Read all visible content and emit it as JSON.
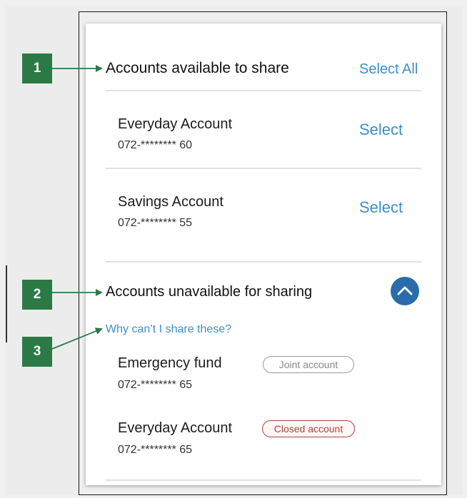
{
  "badges": [
    "1",
    "2",
    "3"
  ],
  "available": {
    "title": "Accounts available to share",
    "select_all": "Select All",
    "accounts": [
      {
        "name": "Everyday Account",
        "number": "072-******** 60",
        "action": "Select"
      },
      {
        "name": "Savings Account",
        "number": "072-******** 55",
        "action": "Select"
      }
    ]
  },
  "unavailable": {
    "title": "Accounts unavailable for sharing",
    "why_link": "Why can’t I share these?",
    "toggle_icon": "chevron-up-icon",
    "accounts": [
      {
        "name": "Emergency fund",
        "number": "072-******** 65",
        "status": "Joint account",
        "status_style": "neutral"
      },
      {
        "name": "Everyday Account",
        "number": "072-******** 65",
        "status": "Closed account",
        "status_style": "error"
      }
    ]
  },
  "colors": {
    "link": "#3d8fc9",
    "toggle": "#2a6cab",
    "badge": "#2b7a46",
    "closed": "#b5403c",
    "joint": "#9a9a9a"
  }
}
